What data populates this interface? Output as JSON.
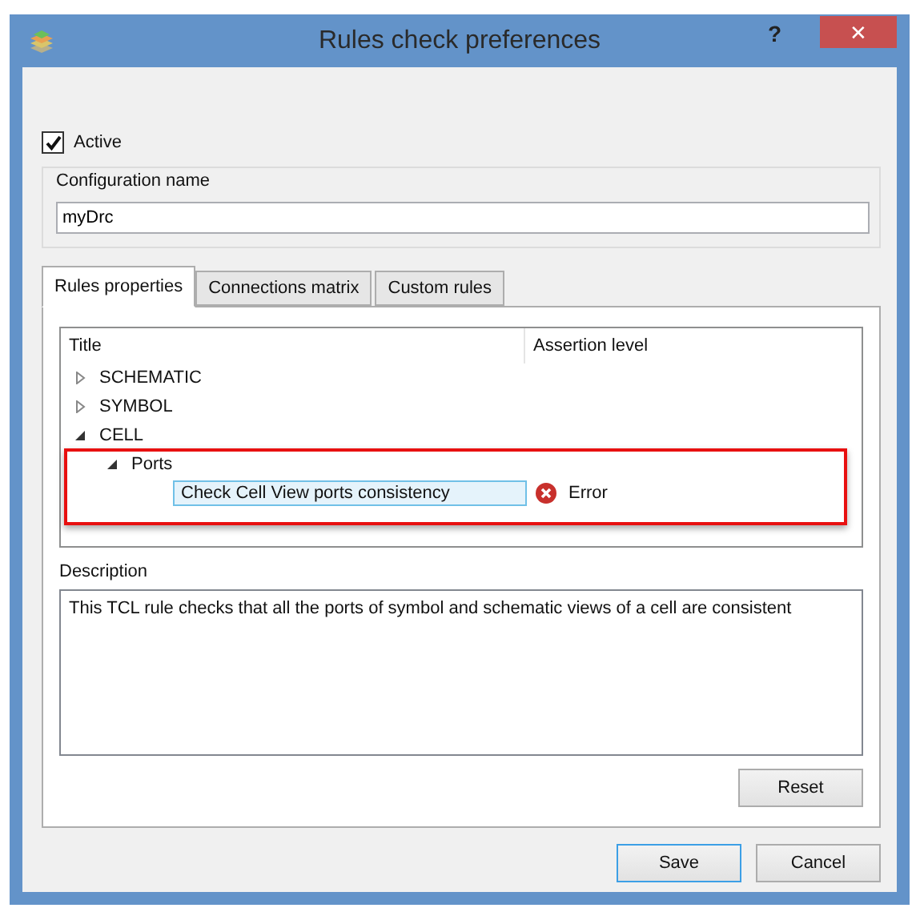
{
  "window": {
    "title": "Rules check preferences",
    "help": "?",
    "close": "✕"
  },
  "active": {
    "label": "Active",
    "checked": true
  },
  "configuration": {
    "label": "Configuration name",
    "value": "myDrc"
  },
  "tabs": [
    {
      "label": "Rules properties",
      "selected": true
    },
    {
      "label": "Connections matrix",
      "selected": false
    },
    {
      "label": "Custom rules",
      "selected": false
    }
  ],
  "tree": {
    "columns": [
      "Title",
      "Assertion level"
    ],
    "items": [
      {
        "label": "SCHEMATIC",
        "expanded": false,
        "selected": false
      },
      {
        "label": "SYMBOL",
        "expanded": false,
        "selected": false
      },
      {
        "label": "CELL",
        "expanded": true,
        "selected": false,
        "children": [
          {
            "label": "Ports",
            "expanded": true,
            "selected": false,
            "children": [
              {
                "label": "Check Cell View ports consistency",
                "selected": true,
                "assertion": {
                  "kind": "error",
                  "text": "Error"
                }
              }
            ]
          }
        ]
      }
    ]
  },
  "description": {
    "label": "Description",
    "text": "This TCL rule checks that all the ports of symbol and schematic views of a cell are consistent"
  },
  "buttons": {
    "reset": "Reset",
    "save": "Save",
    "cancel": "Cancel"
  }
}
